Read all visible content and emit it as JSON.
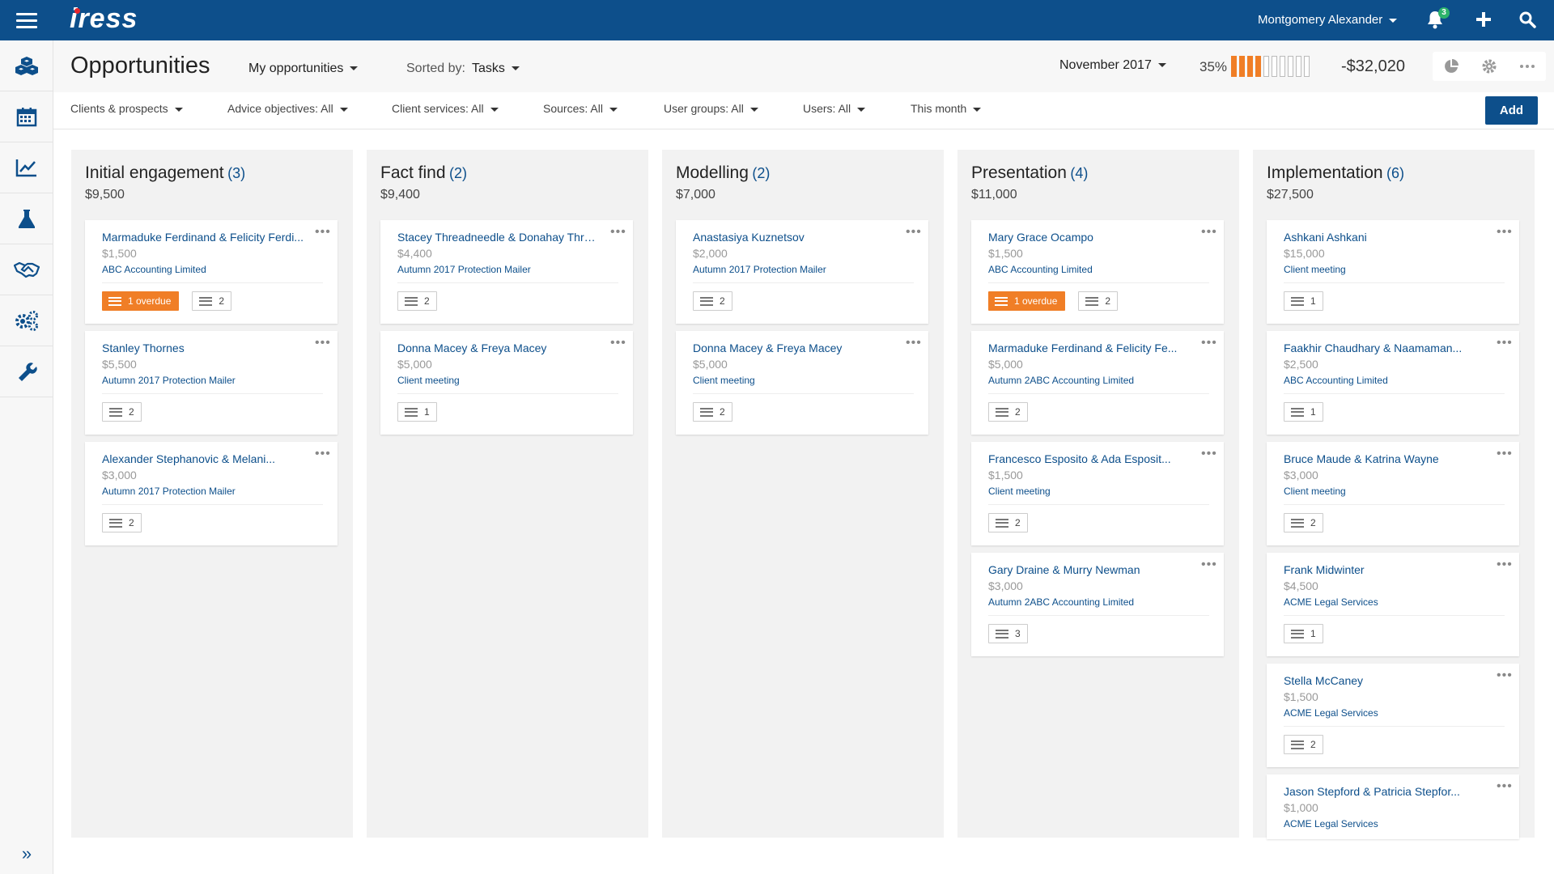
{
  "app": {
    "logo": "iress",
    "user_name": "Montgomery Alexander",
    "notification_count": "3"
  },
  "colors": {
    "brand": "#0d4f8b",
    "overdue": "#f07e26",
    "badge": "#2db36b"
  },
  "icons": {
    "topbar": [
      "hamburger-icon",
      "bell-icon",
      "plus-icon",
      "search-icon"
    ],
    "sidebar": [
      "cubes-icon",
      "calendar-icon",
      "chart-line-icon",
      "flask-icon",
      "handshake-icon",
      "cogs-icon",
      "wrench-icon",
      "expand-icon"
    ]
  },
  "header": {
    "title": "Opportunities",
    "view": "My opportunities",
    "sorted_label": "Sorted by:",
    "sorted_value": "Tasks",
    "period": "November 2017",
    "progress_percent": "35%",
    "progress_fraction": 0.35,
    "net_amount": "-$32,020"
  },
  "filters": {
    "clients": "Clients & prospects",
    "advice": "Advice objectives: All",
    "services": "Client services: All",
    "sources": "Sources: All",
    "user_groups": "User groups: All",
    "users": "Users: All",
    "period": "This month",
    "add": "Add"
  },
  "columns": [
    {
      "title": "Initial engagement",
      "count": "(3)",
      "total": "$9,500",
      "cards": [
        {
          "name": "Marmaduke Ferdinand & Felicity Ferdi...",
          "amount": "$1,500",
          "source": "ABC Accounting Limited",
          "overdue": "1 overdue",
          "tasks": "2"
        },
        {
          "name": "Stanley Thornes",
          "amount": "$5,500",
          "source": "Autumn 2017 Protection Mailer",
          "overdue": "",
          "tasks": "2"
        },
        {
          "name": "Alexander Stephanovic & Melani...",
          "amount": "$3,000",
          "source": "Autumn 2017 Protection Mailer",
          "overdue": "",
          "tasks": "2"
        }
      ]
    },
    {
      "title": "Fact find",
      "count": "(2)",
      "total": "$9,400",
      "cards": [
        {
          "name": "Stacey Threadneedle & Donahay Thra...",
          "amount": "$4,400",
          "source": "Autumn 2017 Protection Mailer",
          "overdue": "",
          "tasks": "2"
        },
        {
          "name": "Donna Macey & Freya Macey",
          "amount": "$5,000",
          "source": "Client meeting",
          "overdue": "",
          "tasks": "1"
        }
      ]
    },
    {
      "title": "Modelling",
      "count": "(2)",
      "total": "$7,000",
      "cards": [
        {
          "name": "Anastasiya Kuznetsov",
          "amount": "$2,000",
          "source": "Autumn 2017 Protection Mailer",
          "overdue": "",
          "tasks": "2"
        },
        {
          "name": "Donna Macey & Freya Macey",
          "amount": "$5,000",
          "source": "Client meeting",
          "overdue": "",
          "tasks": "2"
        }
      ]
    },
    {
      "title": "Presentation",
      "count": "(4)",
      "total": "$11,000",
      "cards": [
        {
          "name": "Mary Grace Ocampo",
          "amount": "$1,500",
          "source": "ABC Accounting Limited",
          "overdue": "1 overdue",
          "tasks": "2"
        },
        {
          "name": "Marmaduke Ferdinand & Felicity Fe...",
          "amount": "$5,000",
          "source": "Autumn 2ABC Accounting Limited",
          "overdue": "",
          "tasks": "2"
        },
        {
          "name": "Francesco Esposito & Ada Esposit...",
          "amount": "$1,500",
          "source": "Client meeting",
          "overdue": "",
          "tasks": "2"
        },
        {
          "name": "Gary Draine & Murry Newman",
          "amount": "$3,000",
          "source": "Autumn 2ABC Accounting Limited",
          "overdue": "",
          "tasks": "3"
        }
      ]
    },
    {
      "title": "Implementation",
      "count": "(6)",
      "total": "$27,500",
      "cards": [
        {
          "name": "Ashkani Ashkani",
          "amount": "$15,000",
          "source": "Client meeting",
          "overdue": "",
          "tasks": "1"
        },
        {
          "name": "Faakhir Chaudhary & Naamaman...",
          "amount": "$2,500",
          "source": "ABC Accounting Limited",
          "overdue": "",
          "tasks": "1"
        },
        {
          "name": "Bruce Maude & Katrina Wayne",
          "amount": "$3,000",
          "source": "Client meeting",
          "overdue": "",
          "tasks": "2"
        },
        {
          "name": "Frank Midwinter",
          "amount": "$4,500",
          "source": "ACME Legal Services",
          "overdue": "",
          "tasks": "1"
        },
        {
          "name": "Stella McCaney",
          "amount": "$1,500",
          "source": "ACME Legal Services",
          "overdue": "",
          "tasks": "2"
        },
        {
          "name": "Jason Stepford & Patricia Stepfor...",
          "amount": "$1,000",
          "source": "ACME Legal Services",
          "overdue": "",
          "tasks": ""
        }
      ]
    }
  ]
}
